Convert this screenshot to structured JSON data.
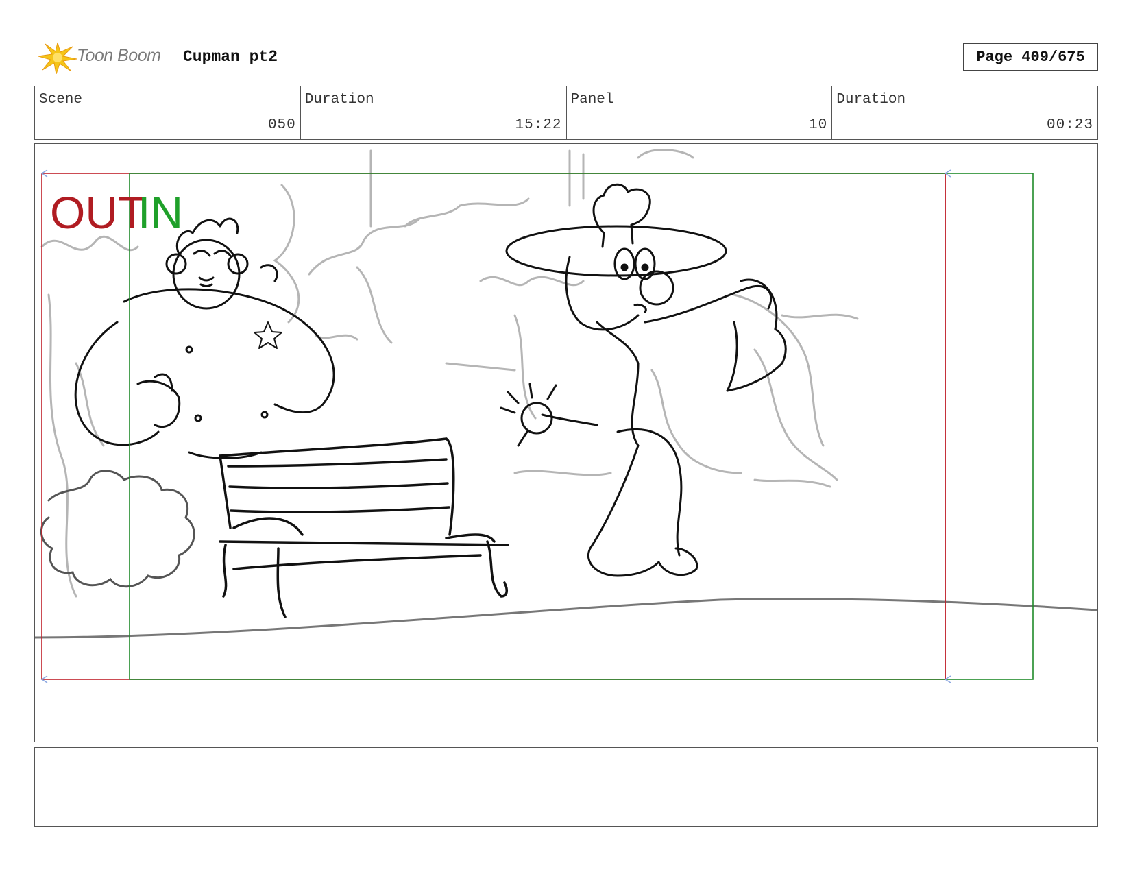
{
  "header": {
    "logo_text": "Toon Boom",
    "project_title": "Cupman pt2",
    "page_label": "Page 409/675"
  },
  "info": [
    {
      "label": "Scene",
      "value": "050"
    },
    {
      "label": "Duration",
      "value": "15:22"
    },
    {
      "label": "Panel",
      "value": "10"
    },
    {
      "label": "Duration",
      "value": "00:23"
    }
  ],
  "panel": {
    "out_label": "OUT",
    "in_label": "IN",
    "colors": {
      "out_frame": "#c0202a",
      "in_frame": "#1f8a2a",
      "sketch": "#111111",
      "background_sketch": "#b5b5b5"
    }
  },
  "notes": {
    "text": ""
  }
}
